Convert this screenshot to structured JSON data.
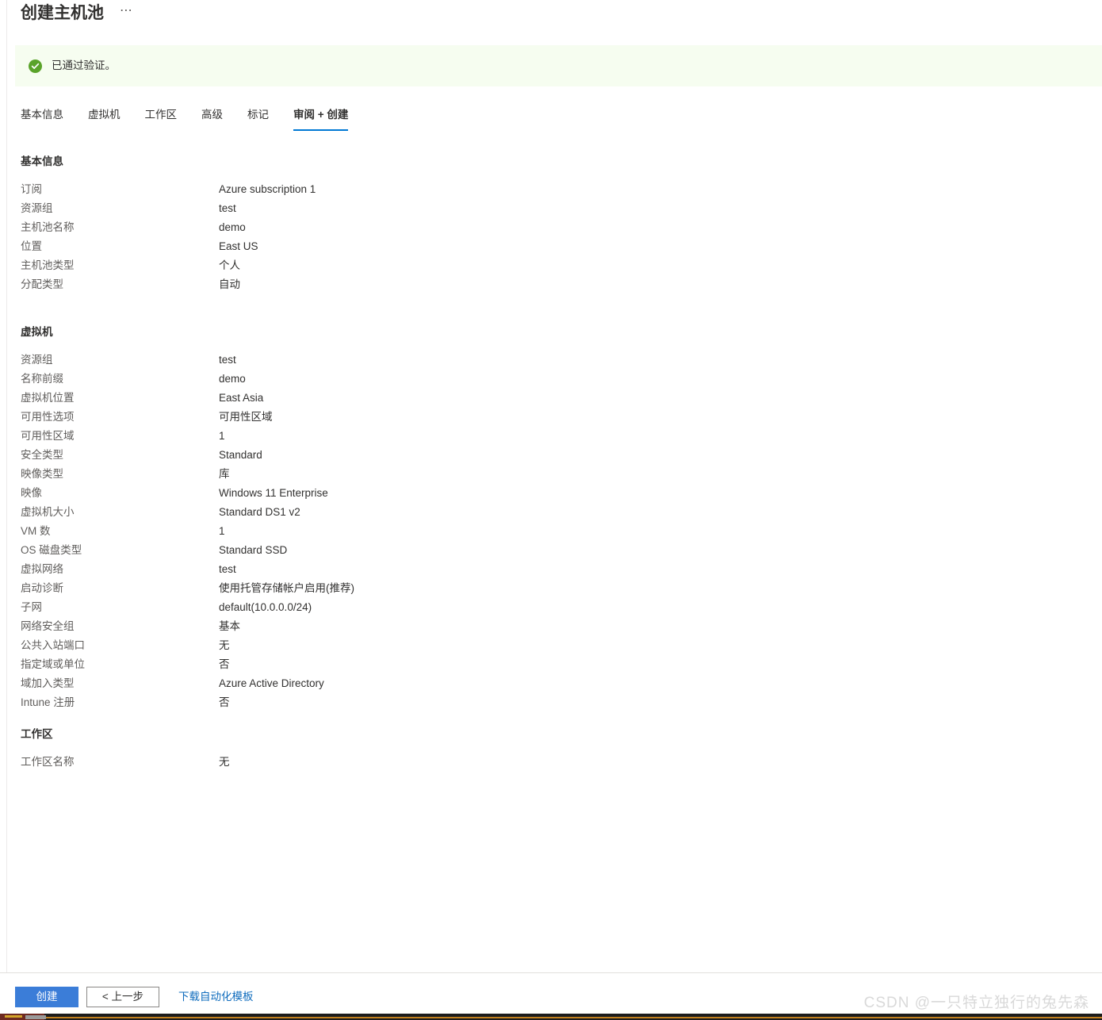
{
  "header": {
    "title": "创建主机池",
    "more_label": "⋯"
  },
  "banner": {
    "icon": "success-check-icon",
    "text": "已通过验证。",
    "background": "#f6fdf0",
    "icon_color": "#5aa32a"
  },
  "tabs": [
    {
      "label": "基本信息",
      "active": false
    },
    {
      "label": "虚拟机",
      "active": false
    },
    {
      "label": "工作区",
      "active": false
    },
    {
      "label": "高级",
      "active": false
    },
    {
      "label": "标记",
      "active": false
    },
    {
      "label": "审阅 + 创建",
      "active": true
    }
  ],
  "sections": [
    {
      "title": "基本信息",
      "rows": [
        {
          "label": "订阅",
          "value": "Azure subscription 1"
        },
        {
          "label": "资源组",
          "value": "test"
        },
        {
          "label": "主机池名称",
          "value": "demo"
        },
        {
          "label": "位置",
          "value": "East US"
        },
        {
          "label": "主机池类型",
          "value": "个人"
        },
        {
          "label": "分配类型",
          "value": "自动"
        }
      ]
    },
    {
      "title": "虚拟机",
      "rows": [
        {
          "label": "资源组",
          "value": "test"
        },
        {
          "label": "名称前缀",
          "value": "demo"
        },
        {
          "label": "虚拟机位置",
          "value": "East Asia"
        },
        {
          "label": "可用性选项",
          "value": "可用性区域"
        },
        {
          "label": "可用性区域",
          "value": "1"
        },
        {
          "label": "安全类型",
          "value": "Standard"
        },
        {
          "label": "映像类型",
          "value": "库"
        },
        {
          "label": "映像",
          "value": "Windows 11 Enterprise"
        },
        {
          "label": "虚拟机大小",
          "value": "Standard DS1 v2"
        },
        {
          "label": "VM 数",
          "value": "1"
        },
        {
          "label": "OS 磁盘类型",
          "value": "Standard SSD"
        },
        {
          "label": "虚拟网络",
          "value": "test"
        },
        {
          "label": "启动诊断",
          "value": "使用托管存储帐户启用(推荐)"
        },
        {
          "label": "子网",
          "value": "default(10.0.0.0/24)"
        },
        {
          "label": "网络安全组",
          "value": "基本"
        },
        {
          "label": "公共入站端口",
          "value": "无"
        },
        {
          "label": "指定域或单位",
          "value": "否"
        },
        {
          "label": "域加入类型",
          "value": "Azure Active Directory"
        },
        {
          "label": "Intune 注册",
          "value": "否"
        }
      ]
    },
    {
      "title": "工作区",
      "rows": [
        {
          "label": "工作区名称",
          "value": "无"
        }
      ]
    }
  ],
  "action_bar": {
    "create_label": "创建",
    "previous_label": "< 上一步",
    "download_template_label": "下载自动化模板",
    "primary_color": "#3b7dd8",
    "link_color": "#0f6cbd"
  },
  "watermark": {
    "text": "CSDN @一只特立独行的兔先森"
  }
}
